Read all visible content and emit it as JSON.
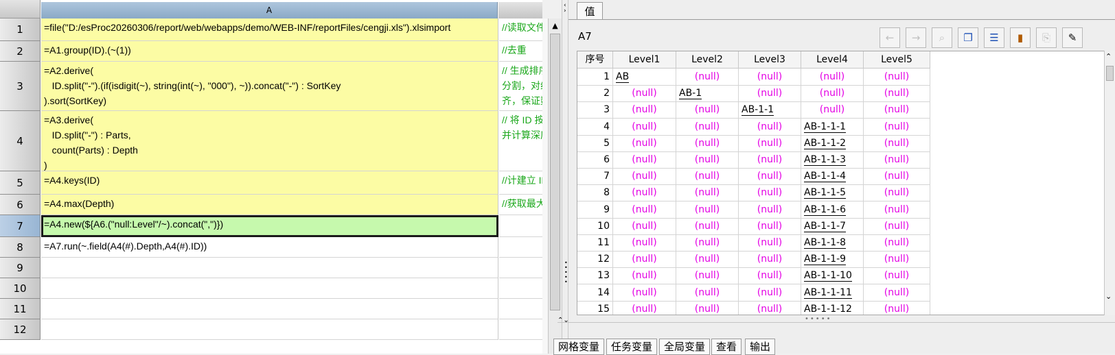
{
  "grid": {
    "column_headers": [
      "A"
    ],
    "rows": [
      {
        "num": "1",
        "formula": "=file(\"D:/esProc20260306/report/web/webapps/demo/WEB-INF/reportFiles/cengji.xls\").xlsimport",
        "comment": "//读取文件"
      },
      {
        "num": "2",
        "formula": "=A1.group(ID).(~(1))",
        "comment": "//去重"
      },
      {
        "num": "3",
        "formula": "=A2.derive(\n   ID.split(\"-\").(if(isdigit(~), string(int(~), \"000\"), ~)).concat(\"-\") : SortKey\n).sort(SortKey)",
        "comment": "// 生成排序\n分割，对纯\n齐，保证数"
      },
      {
        "num": "4",
        "formula": "=A3.derive(\n   ID.split(\"-\") : Parts,\n   count(Parts) : Depth\n)",
        "comment": "// 将 ID 按\n并计算深度"
      },
      {
        "num": "5",
        "formula": "=A4.keys(ID)",
        "comment": "//计建立 ID"
      },
      {
        "num": "6",
        "formula": "=A4.max(Depth)",
        "comment": "//获取最大"
      },
      {
        "num": "7",
        "formula": "=A4.new(${A6.(\"null:Level\"/~).concat(\",\")})",
        "comment": ""
      },
      {
        "num": "8",
        "formula": "=A7.run(~.field(A4(#).Depth,A4(#).ID))",
        "comment": ""
      },
      {
        "num": "9",
        "formula": "",
        "comment": ""
      },
      {
        "num": "10",
        "formula": "",
        "comment": ""
      },
      {
        "num": "11",
        "formula": "",
        "comment": ""
      },
      {
        "num": "12",
        "formula": "",
        "comment": ""
      }
    ]
  },
  "panel": {
    "tab_label": "值",
    "cell_name": "A7",
    "table": {
      "headers": [
        "序号",
        "Level1",
        "Level2",
        "Level3",
        "Level4",
        "Level5"
      ],
      "rows": [
        [
          "1",
          "AB",
          "(null)",
          "(null)",
          "(null)",
          "(null)"
        ],
        [
          "2",
          "(null)",
          "AB-1",
          "(null)",
          "(null)",
          "(null)"
        ],
        [
          "3",
          "(null)",
          "(null)",
          "AB-1-1",
          "(null)",
          "(null)"
        ],
        [
          "4",
          "(null)",
          "(null)",
          "(null)",
          "AB-1-1-1",
          "(null)"
        ],
        [
          "5",
          "(null)",
          "(null)",
          "(null)",
          "AB-1-1-2",
          "(null)"
        ],
        [
          "6",
          "(null)",
          "(null)",
          "(null)",
          "AB-1-1-3",
          "(null)"
        ],
        [
          "7",
          "(null)",
          "(null)",
          "(null)",
          "AB-1-1-4",
          "(null)"
        ],
        [
          "8",
          "(null)",
          "(null)",
          "(null)",
          "AB-1-1-5",
          "(null)"
        ],
        [
          "9",
          "(null)",
          "(null)",
          "(null)",
          "AB-1-1-6",
          "(null)"
        ],
        [
          "10",
          "(null)",
          "(null)",
          "(null)",
          "AB-1-1-7",
          "(null)"
        ],
        [
          "11",
          "(null)",
          "(null)",
          "(null)",
          "AB-1-1-8",
          "(null)"
        ],
        [
          "12",
          "(null)",
          "(null)",
          "(null)",
          "AB-1-1-9",
          "(null)"
        ],
        [
          "13",
          "(null)",
          "(null)",
          "(null)",
          "AB-1-1-10",
          "(null)"
        ],
        [
          "14",
          "(null)",
          "(null)",
          "(null)",
          "AB-1-1-11",
          "(null)"
        ],
        [
          "15",
          "(null)",
          "(null)",
          "(null)",
          "AB-1-1-12",
          "(null)"
        ]
      ]
    },
    "bottom_tabs": [
      "网格变量",
      "任务变量",
      "全局变量",
      "查看",
      "输出"
    ]
  },
  "colors": {
    "null_text": "#e400e4",
    "comment_text": "#1aa71a",
    "yellow_cell": "#fcfca4",
    "selected_cell": "#c6f9ad"
  }
}
